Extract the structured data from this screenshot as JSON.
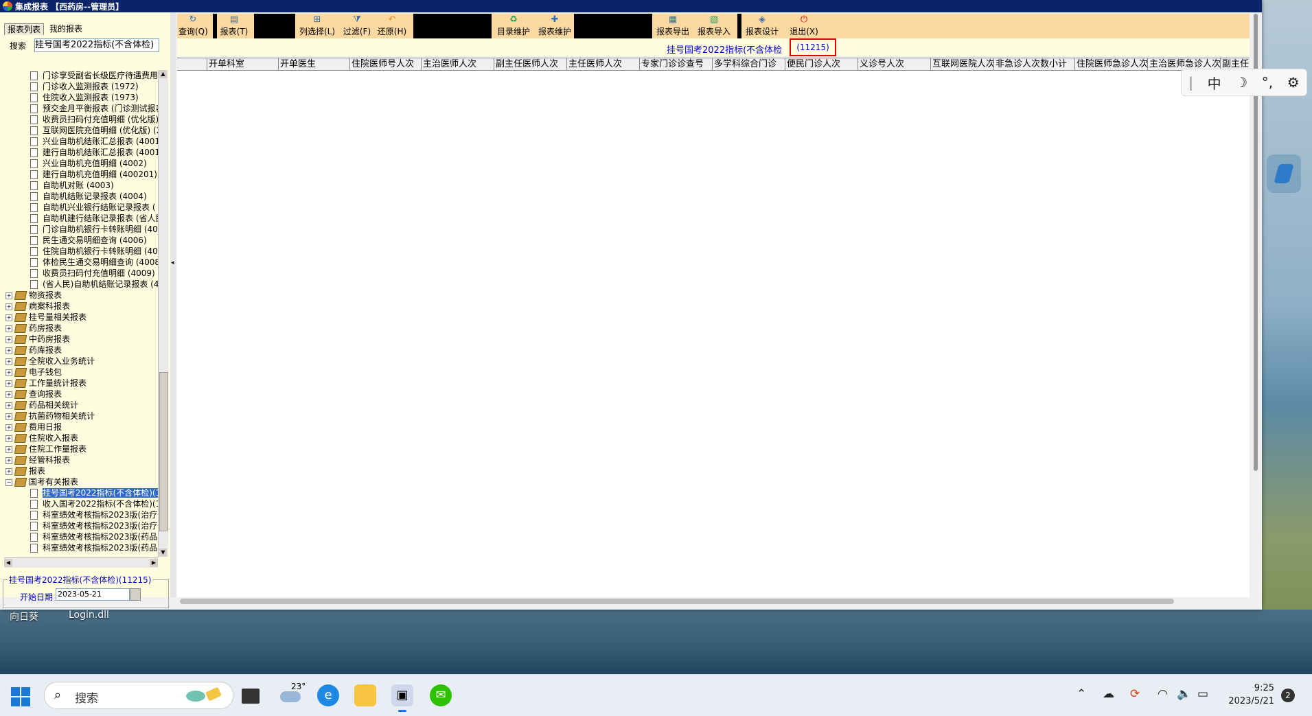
{
  "window": {
    "title": "集成报表 【西药房--管理员】"
  },
  "left_panel": {
    "tabs": [
      "报表列表",
      "我的报表"
    ],
    "search_label": "搜索",
    "search_value": "挂号国考2022指标(不含体检)",
    "tree_children_top": [
      "门诊享受副省长级医疗待遇费用",
      "门诊收入监测报表 (1972)",
      "住院收入监测报表 (1973)",
      "预交金月平衡报表 (门诊测试报表",
      "收费员扫码付充值明细 (优化版)",
      "互联网医院充值明细 (优化版) (2",
      "兴业自助机结账汇总报表 (4001)",
      "建行自助机结账汇总报表 (40010",
      "兴业自助机充值明细 (4002)",
      "建行自助机充值明细 (400201)",
      "自助机对账 (4003)",
      "自助机结账记录报表 (4004)",
      "自助机兴业银行结账记录报表 (",
      "自助机建行结账记录报表 (省人民",
      "门诊自助机银行卡转账明细 (400",
      "民生通交易明细查询 (4006)",
      "住院自助机银行卡转账明细 (400",
      "体检民生通交易明细查询 (4008)",
      "收费员扫码付充值明细 (4009)",
      "(省人民)自助机结账记录报表 (4"
    ],
    "tree_groups": [
      "物资报表",
      "病案科报表",
      "挂号量相关报表",
      "药房报表",
      "中药房报表",
      "药库报表",
      "全院收入业务统计",
      "电子钱包",
      "工作量统计报表",
      "查询报表",
      "药品相关统计",
      "抗菌药物相关统计",
      "费用日报",
      "住院收入报表",
      "住院工作量报表",
      "经管科报表",
      "报表",
      "国考有关报表"
    ],
    "tree_children_bottom": [
      "挂号国考2022指标(不含体检)(1",
      "收入国考2022指标(不含体检)(1",
      "科室绩效考核指标2023版(治疗)",
      "科室绩效考核指标2023版(治疗)",
      "科室绩效考核指标2023版(药品)",
      "科室绩效考核指标2023版(药品)"
    ],
    "selected_index": 0,
    "param_title": "挂号国考2022指标(不含体检)(11215)",
    "start_date_label": "开始日期",
    "start_date_value": "2023-05-21"
  },
  "toolbar": {
    "buttons": [
      {
        "label": "查询(Q)",
        "icon": "query-icon"
      },
      {
        "label": "报表(T)",
        "icon": "report-icon"
      },
      {
        "label": "列选择(L)",
        "icon": "column-select-icon"
      },
      {
        "label": "过滤(F)",
        "icon": "filter-icon"
      },
      {
        "label": "还原(H)",
        "icon": "restore-icon"
      },
      {
        "label": "目录维护",
        "icon": "catalog-icon"
      },
      {
        "label": "报表维护",
        "icon": "plus-icon"
      },
      {
        "label": "报表导出",
        "icon": "export-icon"
      },
      {
        "label": "报表导入",
        "icon": "import-icon"
      },
      {
        "label": "报表设计",
        "icon": "design-icon"
      },
      {
        "label": "退出(X)",
        "icon": "power-icon"
      }
    ]
  },
  "info": {
    "report_name": "挂号国考2022指标(不含体检",
    "report_code": "(11215)"
  },
  "grid": {
    "columns": [
      "",
      "开单科室",
      "开单医生",
      "住院医师号人次",
      "主治医师人次",
      "副主任医师人次",
      "主任医师人次",
      "专家门诊诊查号",
      "多学科综合门诊",
      "便民门诊人次",
      "义诊号人次",
      "互联网医院人次",
      "非急诊人次数小计",
      "住院医师急诊人次",
      "主治医师急诊人次",
      "副主任"
    ]
  },
  "desktop": {
    "labels": [
      "向日葵",
      "Login.dll"
    ]
  },
  "ime": {
    "items": [
      "中",
      "☽",
      "°,",
      "⚙"
    ]
  },
  "taskbar": {
    "search_placeholder": "搜索",
    "weather_temp": "23°",
    "time": "9:25",
    "date": "2023/5/21",
    "notification_count": "2"
  },
  "colors": {
    "titlebar": "#0a246a",
    "toolbar": "#fbd9a0",
    "panel": "#fffde0",
    "highlight": "#e00000",
    "link": "#0000d0"
  }
}
